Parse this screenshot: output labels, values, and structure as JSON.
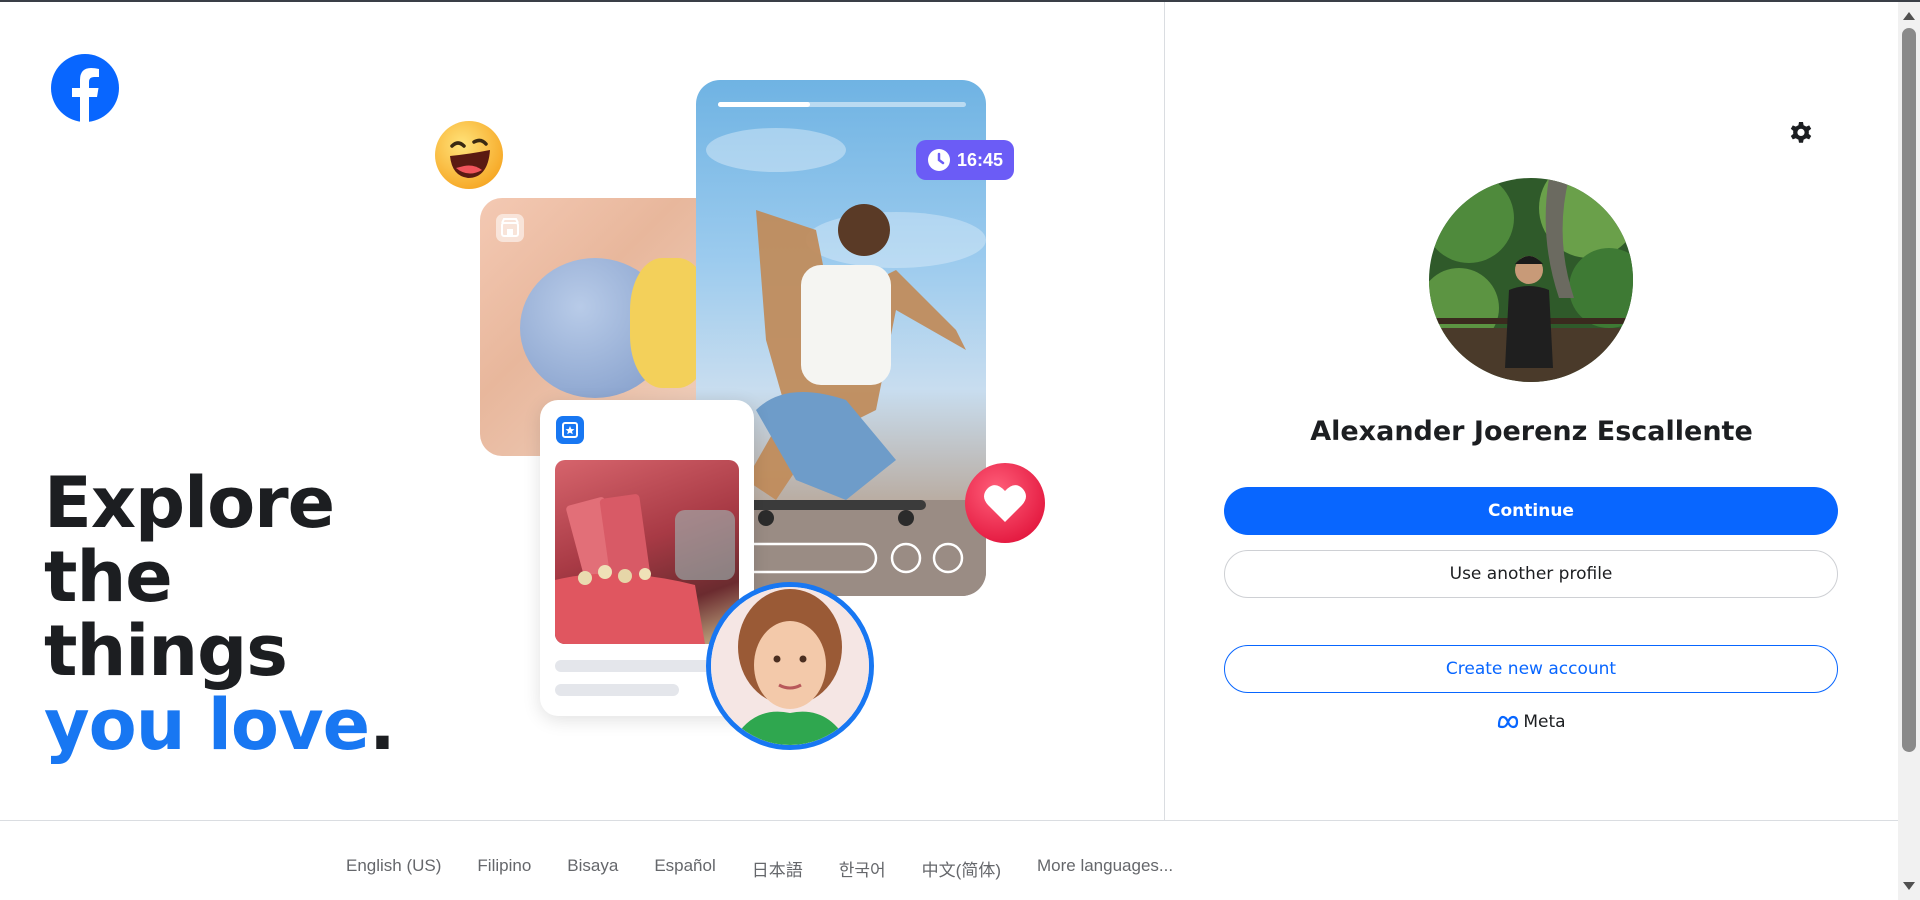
{
  "headline": {
    "line1": "Explore",
    "line2": "the",
    "line3": "things",
    "highlight": "you love",
    "period": "."
  },
  "collage": {
    "time_badge": "16:45",
    "reel_progress_fraction": 0.37
  },
  "profile": {
    "name": "Alexander Joerenz Escallente"
  },
  "buttons": {
    "continue": "Continue",
    "use_another": "Use another profile",
    "create_account": "Create new account"
  },
  "meta_label": "Meta",
  "footer": {
    "languages": [
      "English (US)",
      "Filipino",
      "Bisaya",
      "Español",
      "日本語",
      "한국어",
      "中文(简体)",
      "More languages..."
    ]
  },
  "colors": {
    "brand_blue": "#0866ff",
    "facebook_blue": "#1877f2",
    "text": "#1c1e21"
  },
  "icons": [
    "facebook-logo-icon",
    "settings-gear-icon",
    "laughing-emoji-icon",
    "heart-icon",
    "clock-icon",
    "shop-icon",
    "event-star-icon",
    "meta-logo-icon"
  ]
}
